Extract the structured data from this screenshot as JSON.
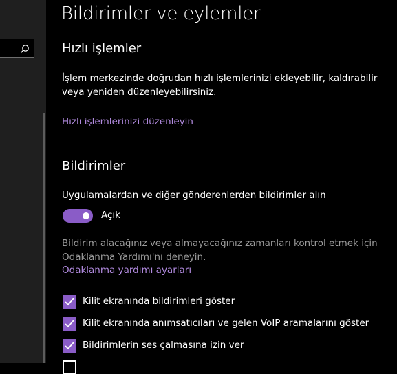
{
  "sidebar": {
    "search_icon": "search-icon"
  },
  "page": {
    "title": "Bildirimler ve eylemler"
  },
  "quick_actions": {
    "title": "Hızlı işlemler",
    "description_line1": "İşlem merkezinde doğrudan hızlı işlemlerinizi ekleyebilir, kaldırabilir",
    "description_line2": "veya yeniden düzenleyebilirsiniz.",
    "edit_link": "Hızlı işlemlerinizi düzenleyin"
  },
  "notifications": {
    "title": "Bildirimler",
    "get_notifications_label": "Uygulamalardan ve diğer gönderenlerden bildirimler alın",
    "toggle_state": "Açık",
    "toggle_on": true,
    "focus_hint_line1": "Bildirim alacağınız veya almayacağınız zamanları kontrol etmek için",
    "focus_hint_line2": "Odaklanma Yardımı'nı deneyin.",
    "focus_link": "Odaklanma yardımı ayarları",
    "checkboxes": [
      {
        "label": "Kilit ekranında bildirimleri göster",
        "checked": true
      },
      {
        "label": "Kilit ekranında anımsatıcıları ve gelen VoIP aramalarını göster",
        "checked": true
      },
      {
        "label": "Bildirimlerin ses çalmasına izin ver",
        "checked": true
      },
      {
        "label": "",
        "checked": false
      }
    ]
  },
  "colors": {
    "accent": "#8a5cc7",
    "link": "#b28be0",
    "background": "#000000",
    "sidebar": "#1f1f1f"
  }
}
